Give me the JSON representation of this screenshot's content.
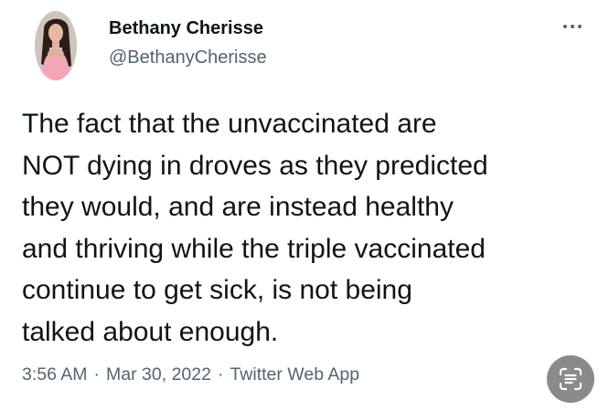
{
  "author": {
    "display_name": "Bethany Cherisse",
    "handle": "@BethanyCherisse"
  },
  "icons": {
    "more": "more-horizontal-icon",
    "scan": "text-scan-icon"
  },
  "tweet": {
    "text_lines": [
      "The fact that the unvaccinated are",
      "NOT dying in droves as they predicted",
      "they would, and are instead healthy",
      "and thriving while the triple vaccinated",
      "continue to get sick, is not being",
      "talked about enough."
    ]
  },
  "meta": {
    "time": "3:56 AM",
    "date": "Mar 30, 2022",
    "source": "Twitter Web App",
    "separator": "·"
  },
  "colors": {
    "text_primary": "#0f1419",
    "text_secondary": "#536471",
    "scan_button_bg": "#8a8a8a"
  }
}
